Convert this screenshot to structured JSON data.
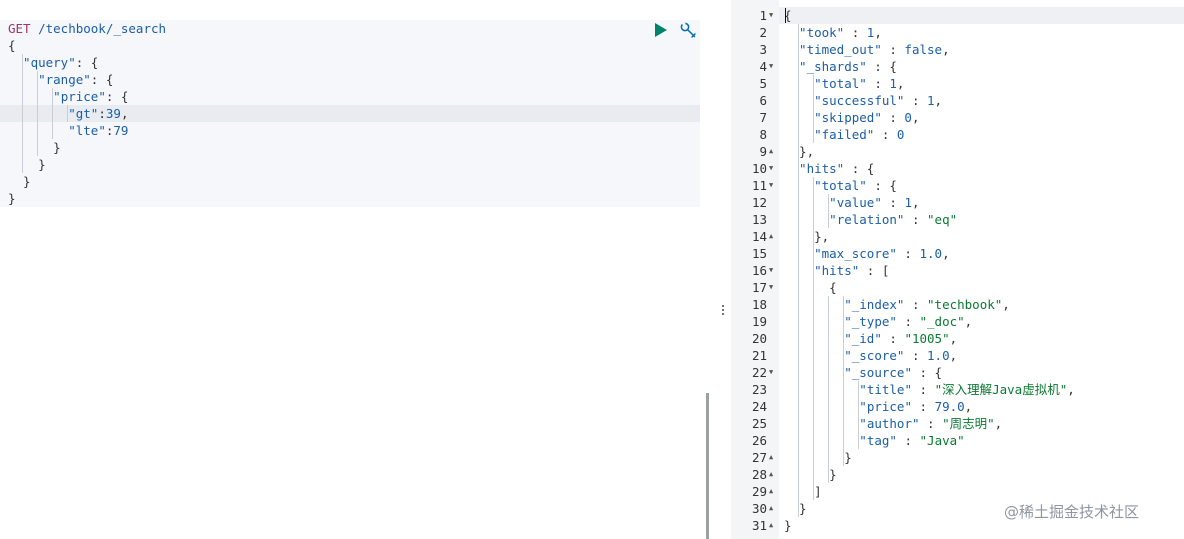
{
  "request": {
    "method": "GET",
    "path": " /techbook/_search",
    "lines": [
      {
        "indent": 0,
        "parts": [
          [
            "pun",
            "{"
          ]
        ]
      },
      {
        "indent": 1,
        "parts": [
          [
            "key",
            "\"query\""
          ],
          [
            "pun",
            ": {"
          ]
        ]
      },
      {
        "indent": 2,
        "parts": [
          [
            "key",
            "\"range\""
          ],
          [
            "pun",
            ": {"
          ]
        ]
      },
      {
        "indent": 3,
        "parts": [
          [
            "key",
            "\"price\""
          ],
          [
            "pun",
            ": {"
          ]
        ]
      },
      {
        "indent": 4,
        "parts": [
          [
            "key",
            "\"gt\""
          ],
          [
            "pun",
            ":"
          ],
          [
            "num",
            "39"
          ],
          [
            "pun",
            ","
          ]
        ]
      },
      {
        "indent": 4,
        "parts": [
          [
            "key",
            "\"lte\""
          ],
          [
            "pun",
            ":"
          ],
          [
            "num",
            "79"
          ]
        ]
      },
      {
        "indent": 3,
        "parts": [
          [
            "pun",
            "}"
          ]
        ]
      },
      {
        "indent": 2,
        "parts": [
          [
            "pun",
            "}"
          ]
        ]
      },
      {
        "indent": 1,
        "parts": [
          [
            "pun",
            "}"
          ]
        ]
      },
      {
        "indent": 0,
        "parts": [
          [
            "pun",
            "}"
          ]
        ]
      }
    ]
  },
  "icons": {
    "run": "play-icon",
    "settings": "wrench-icon",
    "run_color": "#00836b",
    "settings_color": "#006bb8"
  },
  "response": {
    "lines": [
      {
        "n": "1",
        "fold": "down",
        "indent": 0,
        "parts": [
          [
            "pun",
            "{"
          ]
        ]
      },
      {
        "n": "2",
        "indent": 1,
        "parts": [
          [
            "key",
            "\"took\""
          ],
          [
            "pun",
            " : "
          ],
          [
            "num",
            "1"
          ],
          [
            "pun",
            ","
          ]
        ]
      },
      {
        "n": "3",
        "indent": 1,
        "parts": [
          [
            "key",
            "\"timed_out\""
          ],
          [
            "pun",
            " : "
          ],
          [
            "num",
            "false"
          ],
          [
            "pun",
            ","
          ]
        ]
      },
      {
        "n": "4",
        "fold": "down",
        "indent": 1,
        "parts": [
          [
            "key",
            "\"_shards\""
          ],
          [
            "pun",
            " : {"
          ]
        ]
      },
      {
        "n": "5",
        "indent": 2,
        "parts": [
          [
            "key",
            "\"total\""
          ],
          [
            "pun",
            " : "
          ],
          [
            "num",
            "1"
          ],
          [
            "pun",
            ","
          ]
        ]
      },
      {
        "n": "6",
        "indent": 2,
        "parts": [
          [
            "key",
            "\"successful\""
          ],
          [
            "pun",
            " : "
          ],
          [
            "num",
            "1"
          ],
          [
            "pun",
            ","
          ]
        ]
      },
      {
        "n": "7",
        "indent": 2,
        "parts": [
          [
            "key",
            "\"skipped\""
          ],
          [
            "pun",
            " : "
          ],
          [
            "num",
            "0"
          ],
          [
            "pun",
            ","
          ]
        ]
      },
      {
        "n": "8",
        "indent": 2,
        "parts": [
          [
            "key",
            "\"failed\""
          ],
          [
            "pun",
            " : "
          ],
          [
            "num",
            "0"
          ]
        ]
      },
      {
        "n": "9",
        "fold": "up",
        "indent": 1,
        "parts": [
          [
            "pun",
            "},"
          ]
        ]
      },
      {
        "n": "10",
        "fold": "down",
        "indent": 1,
        "parts": [
          [
            "key",
            "\"hits\""
          ],
          [
            "pun",
            " : {"
          ]
        ]
      },
      {
        "n": "11",
        "fold": "down",
        "indent": 2,
        "parts": [
          [
            "key",
            "\"total\""
          ],
          [
            "pun",
            " : {"
          ]
        ]
      },
      {
        "n": "12",
        "indent": 3,
        "parts": [
          [
            "key",
            "\"value\""
          ],
          [
            "pun",
            " : "
          ],
          [
            "num",
            "1"
          ],
          [
            "pun",
            ","
          ]
        ]
      },
      {
        "n": "13",
        "indent": 3,
        "parts": [
          [
            "key",
            "\"relation\""
          ],
          [
            "pun",
            " : "
          ],
          [
            "str",
            "\"eq\""
          ]
        ]
      },
      {
        "n": "14",
        "fold": "up",
        "indent": 2,
        "parts": [
          [
            "pun",
            "},"
          ]
        ]
      },
      {
        "n": "15",
        "indent": 2,
        "parts": [
          [
            "key",
            "\"max_score\""
          ],
          [
            "pun",
            " : "
          ],
          [
            "num",
            "1.0"
          ],
          [
            "pun",
            ","
          ]
        ]
      },
      {
        "n": "16",
        "fold": "down",
        "indent": 2,
        "parts": [
          [
            "key",
            "\"hits\""
          ],
          [
            "pun",
            " : ["
          ]
        ]
      },
      {
        "n": "17",
        "fold": "down",
        "indent": 3,
        "parts": [
          [
            "pun",
            "{"
          ]
        ]
      },
      {
        "n": "18",
        "indent": 4,
        "parts": [
          [
            "key",
            "\"_index\""
          ],
          [
            "pun",
            " : "
          ],
          [
            "str",
            "\"techbook\""
          ],
          [
            "pun",
            ","
          ]
        ]
      },
      {
        "n": "19",
        "indent": 4,
        "parts": [
          [
            "key",
            "\"_type\""
          ],
          [
            "pun",
            " : "
          ],
          [
            "str",
            "\"_doc\""
          ],
          [
            "pun",
            ","
          ]
        ]
      },
      {
        "n": "20",
        "indent": 4,
        "parts": [
          [
            "key",
            "\"_id\""
          ],
          [
            "pun",
            " : "
          ],
          [
            "str",
            "\"1005\""
          ],
          [
            "pun",
            ","
          ]
        ]
      },
      {
        "n": "21",
        "indent": 4,
        "parts": [
          [
            "key",
            "\"_score\""
          ],
          [
            "pun",
            " : "
          ],
          [
            "num",
            "1.0"
          ],
          [
            "pun",
            ","
          ]
        ]
      },
      {
        "n": "22",
        "fold": "down",
        "indent": 4,
        "parts": [
          [
            "key",
            "\"_source\""
          ],
          [
            "pun",
            " : {"
          ]
        ]
      },
      {
        "n": "23",
        "indent": 5,
        "parts": [
          [
            "key",
            "\"title\""
          ],
          [
            "pun",
            " : "
          ],
          [
            "str",
            "\"深入理解Java虚拟机\""
          ],
          [
            "pun",
            ","
          ]
        ]
      },
      {
        "n": "24",
        "indent": 5,
        "parts": [
          [
            "key",
            "\"price\""
          ],
          [
            "pun",
            " : "
          ],
          [
            "num",
            "79.0"
          ],
          [
            "pun",
            ","
          ]
        ]
      },
      {
        "n": "25",
        "indent": 5,
        "parts": [
          [
            "key",
            "\"author\""
          ],
          [
            "pun",
            " : "
          ],
          [
            "str",
            "\"周志明\""
          ],
          [
            "pun",
            ","
          ]
        ]
      },
      {
        "n": "26",
        "indent": 5,
        "parts": [
          [
            "key",
            "\"tag\""
          ],
          [
            "pun",
            " : "
          ],
          [
            "str",
            "\"Java\""
          ]
        ]
      },
      {
        "n": "27",
        "fold": "up",
        "indent": 4,
        "parts": [
          [
            "pun",
            "}"
          ]
        ]
      },
      {
        "n": "28",
        "fold": "up",
        "indent": 3,
        "parts": [
          [
            "pun",
            "}"
          ]
        ]
      },
      {
        "n": "29",
        "fold": "up",
        "indent": 2,
        "parts": [
          [
            "pun",
            "]"
          ]
        ]
      },
      {
        "n": "30",
        "fold": "up",
        "indent": 1,
        "parts": [
          [
            "pun",
            "}"
          ]
        ]
      },
      {
        "n": "31",
        "fold": "up",
        "indent": 0,
        "parts": [
          [
            "pun",
            "}"
          ]
        ]
      }
    ]
  },
  "watermark": "@稀土掘金技术社区"
}
